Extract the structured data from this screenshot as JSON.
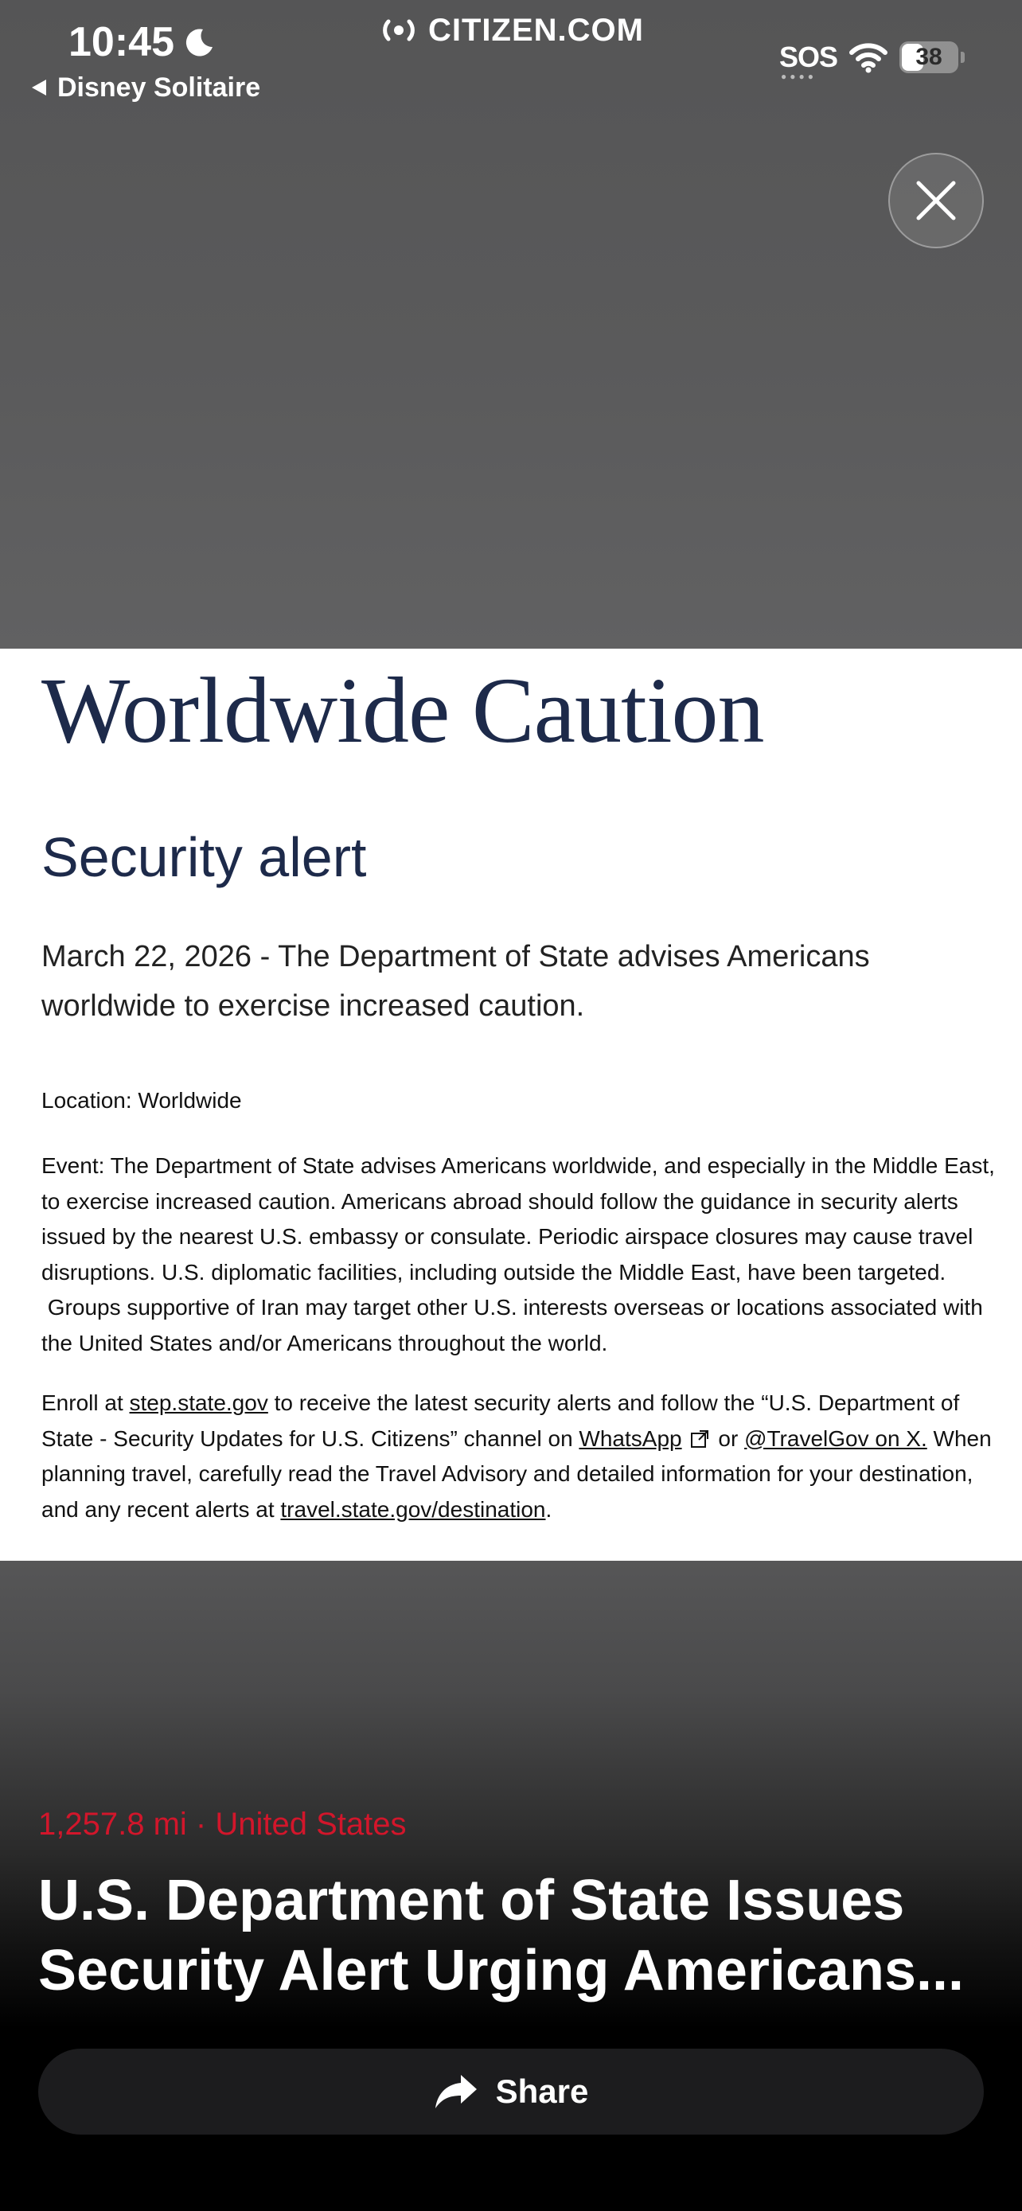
{
  "status_bar": {
    "time": "10:45",
    "back_app": "Disney Solitaire",
    "url": "CITIZEN.COM",
    "sos": "SOS",
    "battery": "38"
  },
  "document": {
    "title": "Worldwide Caution",
    "subtitle": "Security alert",
    "lead_line1": "March 22, 2026 - The Department of State advises Americans",
    "lead_line2": "worldwide to exercise increased caution.",
    "location": "Location: Worldwide",
    "event_lines": [
      "Event: The Department of State advises Americans worldwide, and especially in the Middle East,",
      "to exercise increased caution.  Americans abroad should follow the guidance in security alerts",
      "issued by the nearest U.S. embassy or consulate.  Periodic airspace closures may cause travel",
      "disruptions.  U.S. diplomatic facilities, including outside the Middle East, have been targeted.",
      " Groups supportive of Iran may target other U.S. interests overseas or locations associated with",
      "the United States and/or Americans throughout the world."
    ],
    "enroll": {
      "prefix": "Enroll at ",
      "link_step": "step.state.gov",
      "middle1": " to receive the latest security alerts and follow the “U.S. Department of",
      "line2_start": "State - Security Updates for U.S. Citizens” channel on ",
      "link_whatsapp": "WhatsApp",
      "or_text": " or ",
      "link_x": "@TravelGov on X.",
      "line2_end": "  When",
      "line3": "planning travel, carefully read the Travel Advisory and detailed information for your destination,",
      "line4_start": "and any recent alerts at ",
      "link_travel": "travel.state.gov/destination",
      "line4_end": "."
    }
  },
  "story": {
    "meta": "1,257.8 mi · United States",
    "headline_line1": "U.S. Department of State Issues",
    "headline_line2": "Security Alert Urging Americans...",
    "share_label": "Share"
  },
  "colors": {
    "meta_red": "#d2162b",
    "title_navy": "#1d2a4a"
  },
  "icons": [
    "moon-icon",
    "back-triangle-icon",
    "live-broadcast-icon",
    "wifi-icon",
    "close-icon",
    "external-link-icon",
    "share-arrow-icon"
  ]
}
